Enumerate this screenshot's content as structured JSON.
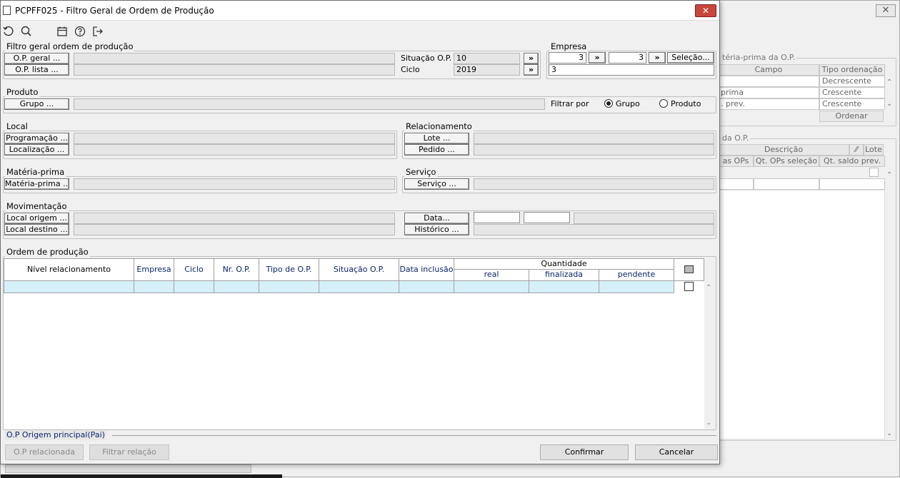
{
  "background": {
    "panel1": {
      "title": "téria-prima da O.P.",
      "headers": [
        "Campo",
        "Tipo ordenação"
      ],
      "rows": [
        [
          "",
          "Decrescente"
        ],
        [
          "prima",
          "Crescente"
        ],
        [
          ". prev.",
          "Crescente"
        ]
      ],
      "order_button": "Ordenar"
    },
    "panel2": {
      "title": " da O.P.",
      "headers1": [
        "Descrição",
        "Lote"
      ],
      "headers2": [
        "as OPs",
        "Qt. OPs seleção",
        "Qt. saldo prev."
      ]
    }
  },
  "window": {
    "title": "PCPFF025 - Filtro Geral de Ordem de Produção",
    "close": "✕"
  },
  "toolbar": {
    "icons": [
      "undo-icon",
      "search-icon",
      "calendar-icon",
      "help-icon",
      "exit-icon"
    ]
  },
  "filtro": {
    "title": "Filtro geral ordem de produção",
    "op_geral": "O.P. geral ...",
    "op_lista": "O.P. lista ...",
    "situacao_label": "Situação O.P.",
    "situacao_value": "10",
    "ciclo_label": "Ciclo",
    "ciclo_value": "2019",
    "arrow": "»"
  },
  "empresa": {
    "title": "Empresa",
    "from": "3",
    "to": "3",
    "arrow": "»",
    "selecao": "Seleção...",
    "value": "3"
  },
  "produto": {
    "title": "Produto",
    "grupo_btn": "Grupo ...",
    "filtrar_label": "Filtrar por",
    "opt_grupo": "Grupo",
    "opt_produto": "Produto",
    "selected": "Grupo"
  },
  "local": {
    "title": "Local",
    "programacao": "Programação ...",
    "localizacao": "Localização ..."
  },
  "relacionamento": {
    "title": "Relacionamento",
    "lote": "Lote ...",
    "pedido": "Pedido ..."
  },
  "materia": {
    "title": "Matéria-prima",
    "btn": "Matéria-prima ..."
  },
  "servico": {
    "title": "Serviço",
    "btn": "Serviço ..."
  },
  "movimentacao": {
    "title": "Movimentação",
    "local_origem": "Local origem ...",
    "local_destino": "Local destino ...",
    "data": "Data...",
    "historico": "Histórico ..."
  },
  "ordem": {
    "title": "Ordem de produção",
    "columns": [
      "Nível relacionamento",
      "Empresa",
      "Ciclo",
      "Nr. O.P.",
      "Tipo de O.P.",
      "Situação O.P.",
      "Data inclusão"
    ],
    "quantidade": "Quantidade",
    "qty_columns": [
      "real",
      "finalizada",
      "pendente"
    ]
  },
  "footer": {
    "op_origem": "O.P Origem principal(Pai)",
    "op_relacionada": "O.P relacionada",
    "filtrar_relacao": "Filtrar relação",
    "confirmar": "Confirmar",
    "cancelar": "Cancelar"
  },
  "colors": {
    "row_highlight": "#d6f0fa",
    "header_text": "#0a246a",
    "close_red": "#c9463d"
  }
}
